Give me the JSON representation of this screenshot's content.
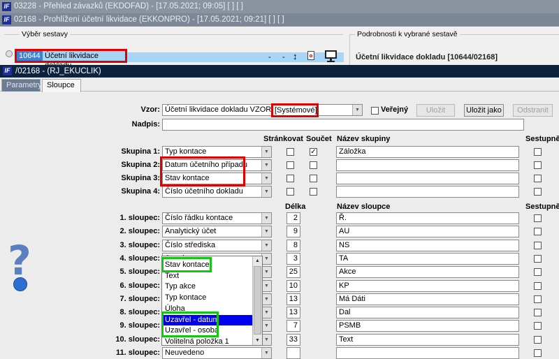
{
  "windows": {
    "win1_title": "03228 - Přehled závazků (EKDOFAD) - [17.05.2021; 09:05] [ ] [ ]",
    "win2_title": "02168 - Prohlížení účetní likvidace (EKKONPRO) - [17.05.2021; 09:21] [ ] [ ]",
    "win2_group_left": "Výběr sestavy",
    "win2_group_right": "Podrobnosti k vybrané sestavě",
    "win2_report_id": "10644",
    "win2_report_name": "Účetní likvidace dokladu",
    "win2_detail": "Účetní likvidace dokladu [10644/02168]",
    "win2_dash1": "-",
    "win2_dash2": "-",
    "win2_arrow": "↕",
    "app_logo": "IF",
    "dialog_title": "/02168 - (RJ_EKUCLIK)"
  },
  "tabs": [
    {
      "label": "Parametry",
      "active": false
    },
    {
      "label": "Sloupce",
      "active": true
    }
  ],
  "form": {
    "vzor_label": "Vzor:",
    "vzor_value": "Účetní likvidace dokladu VZOR   ()",
    "vzor_system": "[Systémové]",
    "verejny_label": "Veřejný",
    "btn_ulozit": "Uložit",
    "btn_ulozit_jako": "Uložit jako",
    "btn_odstranit": "Odstranit",
    "nadpis_label": "Nadpis:",
    "nadpis_value": ""
  },
  "group_headers": {
    "strankovat": "Stránkovat",
    "soucet": "Součet",
    "nazev_skupiny": "Název skupiny",
    "sestupne": "Sestupně"
  },
  "groups": [
    {
      "label": "Skupina 1:",
      "value": "Typ kontace",
      "strankovat": false,
      "soucet": true,
      "name": "Záložka",
      "sestupne": false
    },
    {
      "label": "Skupina 2:",
      "value": "Datum účetního případu",
      "strankovat": false,
      "soucet": false,
      "name": "",
      "sestupne": false
    },
    {
      "label": "Skupina 3:",
      "value": "Stav kontace",
      "strankovat": false,
      "soucet": false,
      "name": "",
      "sestupne": false
    },
    {
      "label": "Skupina 4:",
      "value": "Číslo účetního dokladu",
      "strankovat": false,
      "soucet": false,
      "name": "",
      "sestupne": false
    }
  ],
  "column_headers": {
    "delka": "Délka",
    "nazev_sloupce": "Název sloupce",
    "sestupne": "Sestupně"
  },
  "columns": [
    {
      "label": "1. sloupec:",
      "value": "Číslo řádku kontace",
      "delka": "2",
      "name": "Ř.",
      "sestupne": false
    },
    {
      "label": "2. sloupec:",
      "value": "Analytický účet",
      "delka": "9",
      "name": "AU",
      "sestupne": false
    },
    {
      "label": "3. sloupec:",
      "value": "Číslo střediska",
      "delka": "8",
      "name": "NS",
      "sestupne": false
    },
    {
      "label": "4. sloupec:",
      "value": "Stav kontace",
      "delka": "3",
      "name": "TA",
      "sestupne": false
    },
    {
      "label": "5. sloupec:",
      "value": "",
      "delka": "25",
      "name": "Akce",
      "sestupne": false
    },
    {
      "label": "6. sloupec:",
      "value": "",
      "delka": "10",
      "name": "KP",
      "sestupne": false
    },
    {
      "label": "7. sloupec:",
      "value": "",
      "delka": "13",
      "name": "Má Dáti",
      "sestupne": false
    },
    {
      "label": "8. sloupec:",
      "value": "",
      "delka": "13",
      "name": "Dal",
      "sestupne": false
    },
    {
      "label": "9. sloupec:",
      "value": "",
      "delka": "7",
      "name": "PSMB",
      "sestupne": false
    },
    {
      "label": "10. sloupec:",
      "value": "",
      "delka": "33",
      "name": "Text",
      "sestupne": false
    },
    {
      "label": "11. sloupec:",
      "value": "Neuvedeno",
      "delka": "",
      "name": "",
      "sestupne": false
    }
  ],
  "dropdown": {
    "items": [
      "Stav kontace",
      "Text",
      "Typ akce",
      "Typ kontace",
      "Úloha",
      "Uzavřel - datum",
      "Uzavřel - osoba",
      "Volitelná položka 1"
    ],
    "selected": "Uzavřel - datum"
  },
  "help_icon": "?",
  "colors": {
    "highlight_red": "#e00000",
    "highlight_green": "#13c613",
    "selection_blue": "#0000f0",
    "dark_bar": "#0c2340"
  }
}
